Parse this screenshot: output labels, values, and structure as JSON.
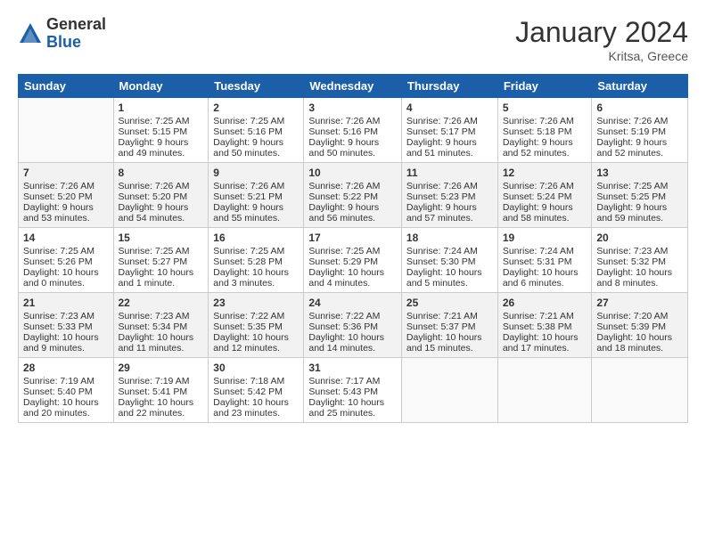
{
  "logo": {
    "general": "General",
    "blue": "Blue"
  },
  "title": "January 2024",
  "location": "Kritsa, Greece",
  "weekdays": [
    "Sunday",
    "Monday",
    "Tuesday",
    "Wednesday",
    "Thursday",
    "Friday",
    "Saturday"
  ],
  "weeks": [
    [
      {
        "day": "",
        "info": ""
      },
      {
        "day": "1",
        "info": "Sunrise: 7:25 AM\nSunset: 5:15 PM\nDaylight: 9 hours\nand 49 minutes."
      },
      {
        "day": "2",
        "info": "Sunrise: 7:25 AM\nSunset: 5:16 PM\nDaylight: 9 hours\nand 50 minutes."
      },
      {
        "day": "3",
        "info": "Sunrise: 7:26 AM\nSunset: 5:16 PM\nDaylight: 9 hours\nand 50 minutes."
      },
      {
        "day": "4",
        "info": "Sunrise: 7:26 AM\nSunset: 5:17 PM\nDaylight: 9 hours\nand 51 minutes."
      },
      {
        "day": "5",
        "info": "Sunrise: 7:26 AM\nSunset: 5:18 PM\nDaylight: 9 hours\nand 52 minutes."
      },
      {
        "day": "6",
        "info": "Sunrise: 7:26 AM\nSunset: 5:19 PM\nDaylight: 9 hours\nand 52 minutes."
      }
    ],
    [
      {
        "day": "7",
        "info": "Sunrise: 7:26 AM\nSunset: 5:20 PM\nDaylight: 9 hours\nand 53 minutes."
      },
      {
        "day": "8",
        "info": "Sunrise: 7:26 AM\nSunset: 5:20 PM\nDaylight: 9 hours\nand 54 minutes."
      },
      {
        "day": "9",
        "info": "Sunrise: 7:26 AM\nSunset: 5:21 PM\nDaylight: 9 hours\nand 55 minutes."
      },
      {
        "day": "10",
        "info": "Sunrise: 7:26 AM\nSunset: 5:22 PM\nDaylight: 9 hours\nand 56 minutes."
      },
      {
        "day": "11",
        "info": "Sunrise: 7:26 AM\nSunset: 5:23 PM\nDaylight: 9 hours\nand 57 minutes."
      },
      {
        "day": "12",
        "info": "Sunrise: 7:26 AM\nSunset: 5:24 PM\nDaylight: 9 hours\nand 58 minutes."
      },
      {
        "day": "13",
        "info": "Sunrise: 7:25 AM\nSunset: 5:25 PM\nDaylight: 9 hours\nand 59 minutes."
      }
    ],
    [
      {
        "day": "14",
        "info": "Sunrise: 7:25 AM\nSunset: 5:26 PM\nDaylight: 10 hours\nand 0 minutes."
      },
      {
        "day": "15",
        "info": "Sunrise: 7:25 AM\nSunset: 5:27 PM\nDaylight: 10 hours\nand 1 minute."
      },
      {
        "day": "16",
        "info": "Sunrise: 7:25 AM\nSunset: 5:28 PM\nDaylight: 10 hours\nand 3 minutes."
      },
      {
        "day": "17",
        "info": "Sunrise: 7:25 AM\nSunset: 5:29 PM\nDaylight: 10 hours\nand 4 minutes."
      },
      {
        "day": "18",
        "info": "Sunrise: 7:24 AM\nSunset: 5:30 PM\nDaylight: 10 hours\nand 5 minutes."
      },
      {
        "day": "19",
        "info": "Sunrise: 7:24 AM\nSunset: 5:31 PM\nDaylight: 10 hours\nand 6 minutes."
      },
      {
        "day": "20",
        "info": "Sunrise: 7:23 AM\nSunset: 5:32 PM\nDaylight: 10 hours\nand 8 minutes."
      }
    ],
    [
      {
        "day": "21",
        "info": "Sunrise: 7:23 AM\nSunset: 5:33 PM\nDaylight: 10 hours\nand 9 minutes."
      },
      {
        "day": "22",
        "info": "Sunrise: 7:23 AM\nSunset: 5:34 PM\nDaylight: 10 hours\nand 11 minutes."
      },
      {
        "day": "23",
        "info": "Sunrise: 7:22 AM\nSunset: 5:35 PM\nDaylight: 10 hours\nand 12 minutes."
      },
      {
        "day": "24",
        "info": "Sunrise: 7:22 AM\nSunset: 5:36 PM\nDaylight: 10 hours\nand 14 minutes."
      },
      {
        "day": "25",
        "info": "Sunrise: 7:21 AM\nSunset: 5:37 PM\nDaylight: 10 hours\nand 15 minutes."
      },
      {
        "day": "26",
        "info": "Sunrise: 7:21 AM\nSunset: 5:38 PM\nDaylight: 10 hours\nand 17 minutes."
      },
      {
        "day": "27",
        "info": "Sunrise: 7:20 AM\nSunset: 5:39 PM\nDaylight: 10 hours\nand 18 minutes."
      }
    ],
    [
      {
        "day": "28",
        "info": "Sunrise: 7:19 AM\nSunset: 5:40 PM\nDaylight: 10 hours\nand 20 minutes."
      },
      {
        "day": "29",
        "info": "Sunrise: 7:19 AM\nSunset: 5:41 PM\nDaylight: 10 hours\nand 22 minutes."
      },
      {
        "day": "30",
        "info": "Sunrise: 7:18 AM\nSunset: 5:42 PM\nDaylight: 10 hours\nand 23 minutes."
      },
      {
        "day": "31",
        "info": "Sunrise: 7:17 AM\nSunset: 5:43 PM\nDaylight: 10 hours\nand 25 minutes."
      },
      {
        "day": "",
        "info": ""
      },
      {
        "day": "",
        "info": ""
      },
      {
        "day": "",
        "info": ""
      }
    ]
  ]
}
